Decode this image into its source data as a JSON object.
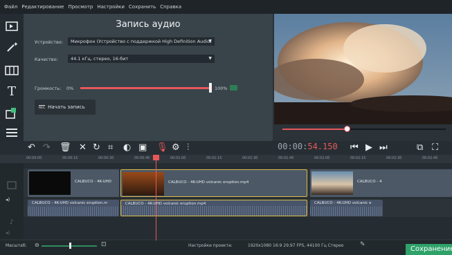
{
  "menu": [
    "Файл",
    "Редактирование",
    "Просмотр",
    "Настройки",
    "Сохранить",
    "Справка"
  ],
  "left_tools": [
    "import-icon",
    "magic-wand-icon",
    "transitions-icon",
    "titles-icon",
    "stickers-icon",
    "more-icon"
  ],
  "record_panel": {
    "title": "Запись аудио",
    "device_label": "Устройство:",
    "device_value": "Микрофон (Устройство с поддержкой High Definition Audio)",
    "quality_label": "Качество:",
    "quality_value": "44.1 кГц, стерео, 16-бит",
    "volume_label": "Громкость:",
    "volume_min": "0%",
    "volume_max": "100%",
    "volume_level": 1.0,
    "rec_badge": "REC",
    "record_button": "Начать запись"
  },
  "player": {
    "progress": 0.39,
    "timecode_grey": "00:00:",
    "timecode_red": "54.150"
  },
  "ruler_ticks": [
    "00:00:00",
    "00:00:15",
    "00:00:30",
    "00:00:45",
    "00:01:00",
    "00:01:15",
    "00:01:30",
    "00:01:45",
    "00:02:00",
    "00:02:15",
    "00:02:30",
    "00:02:45"
  ],
  "video_clips": [
    {
      "label": "CALBUCO - 4K-UHD"
    },
    {
      "label": "CALBUCO - 4K-UHD volcanic eruption.mp4"
    },
    {
      "label": "CALBUCO - 4"
    }
  ],
  "audio_clips": [
    {
      "label": "CALBUCO - 4K-UHD volcanic eruption.m"
    },
    {
      "label": "CALBUCO - 4K-UHD volcanic eruption.mp4"
    },
    {
      "label": "CALBUCO - 4K-UHD volcanic e"
    }
  ],
  "status": {
    "zoom_label": "Масштаб:",
    "project_settings_label": "Настройки проекта:",
    "project_settings_value": "1920x1080 16:9 29.97 FPS, 44100 Гц Стерео",
    "save_button": "Сохранение"
  },
  "colors": {
    "accent": "#e8585a",
    "save": "#2fa26a"
  }
}
